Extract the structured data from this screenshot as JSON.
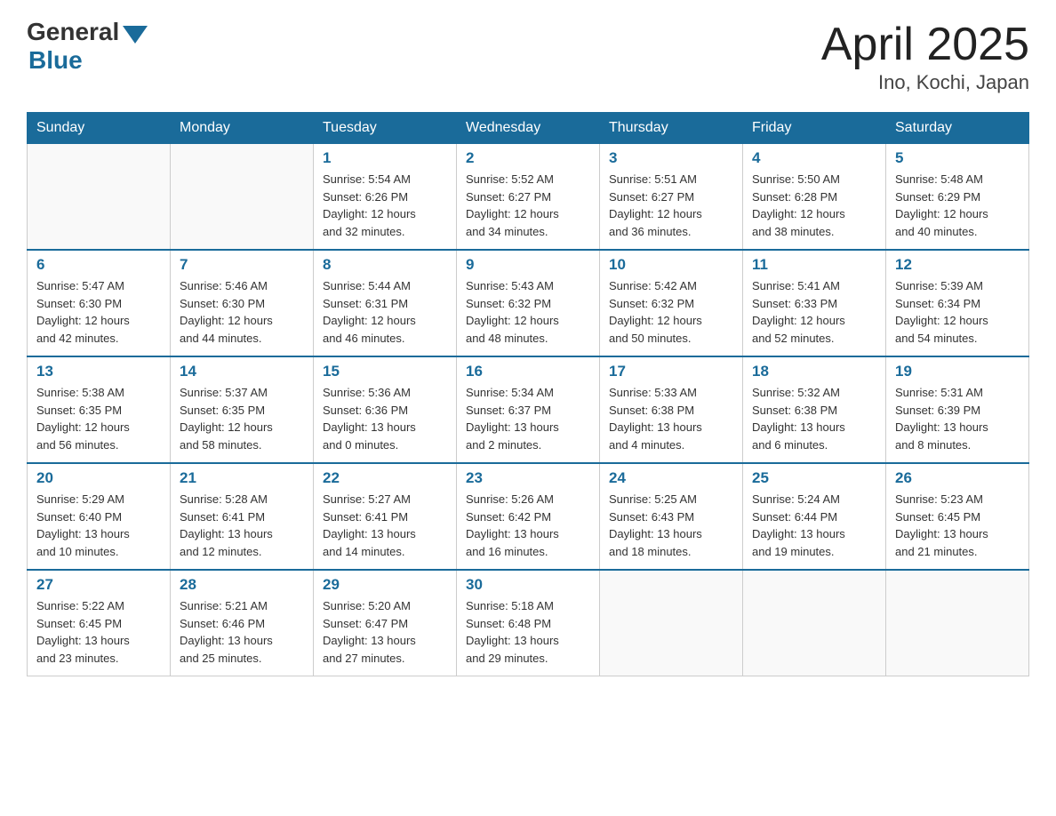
{
  "header": {
    "logo_general": "General",
    "logo_blue": "Blue",
    "title": "April 2025",
    "subtitle": "Ino, Kochi, Japan"
  },
  "weekdays": [
    "Sunday",
    "Monday",
    "Tuesday",
    "Wednesday",
    "Thursday",
    "Friday",
    "Saturday"
  ],
  "weeks": [
    [
      {
        "day": "",
        "info": ""
      },
      {
        "day": "",
        "info": ""
      },
      {
        "day": "1",
        "info": "Sunrise: 5:54 AM\nSunset: 6:26 PM\nDaylight: 12 hours\nand 32 minutes."
      },
      {
        "day": "2",
        "info": "Sunrise: 5:52 AM\nSunset: 6:27 PM\nDaylight: 12 hours\nand 34 minutes."
      },
      {
        "day": "3",
        "info": "Sunrise: 5:51 AM\nSunset: 6:27 PM\nDaylight: 12 hours\nand 36 minutes."
      },
      {
        "day": "4",
        "info": "Sunrise: 5:50 AM\nSunset: 6:28 PM\nDaylight: 12 hours\nand 38 minutes."
      },
      {
        "day": "5",
        "info": "Sunrise: 5:48 AM\nSunset: 6:29 PM\nDaylight: 12 hours\nand 40 minutes."
      }
    ],
    [
      {
        "day": "6",
        "info": "Sunrise: 5:47 AM\nSunset: 6:30 PM\nDaylight: 12 hours\nand 42 minutes."
      },
      {
        "day": "7",
        "info": "Sunrise: 5:46 AM\nSunset: 6:30 PM\nDaylight: 12 hours\nand 44 minutes."
      },
      {
        "day": "8",
        "info": "Sunrise: 5:44 AM\nSunset: 6:31 PM\nDaylight: 12 hours\nand 46 minutes."
      },
      {
        "day": "9",
        "info": "Sunrise: 5:43 AM\nSunset: 6:32 PM\nDaylight: 12 hours\nand 48 minutes."
      },
      {
        "day": "10",
        "info": "Sunrise: 5:42 AM\nSunset: 6:32 PM\nDaylight: 12 hours\nand 50 minutes."
      },
      {
        "day": "11",
        "info": "Sunrise: 5:41 AM\nSunset: 6:33 PM\nDaylight: 12 hours\nand 52 minutes."
      },
      {
        "day": "12",
        "info": "Sunrise: 5:39 AM\nSunset: 6:34 PM\nDaylight: 12 hours\nand 54 minutes."
      }
    ],
    [
      {
        "day": "13",
        "info": "Sunrise: 5:38 AM\nSunset: 6:35 PM\nDaylight: 12 hours\nand 56 minutes."
      },
      {
        "day": "14",
        "info": "Sunrise: 5:37 AM\nSunset: 6:35 PM\nDaylight: 12 hours\nand 58 minutes."
      },
      {
        "day": "15",
        "info": "Sunrise: 5:36 AM\nSunset: 6:36 PM\nDaylight: 13 hours\nand 0 minutes."
      },
      {
        "day": "16",
        "info": "Sunrise: 5:34 AM\nSunset: 6:37 PM\nDaylight: 13 hours\nand 2 minutes."
      },
      {
        "day": "17",
        "info": "Sunrise: 5:33 AM\nSunset: 6:38 PM\nDaylight: 13 hours\nand 4 minutes."
      },
      {
        "day": "18",
        "info": "Sunrise: 5:32 AM\nSunset: 6:38 PM\nDaylight: 13 hours\nand 6 minutes."
      },
      {
        "day": "19",
        "info": "Sunrise: 5:31 AM\nSunset: 6:39 PM\nDaylight: 13 hours\nand 8 minutes."
      }
    ],
    [
      {
        "day": "20",
        "info": "Sunrise: 5:29 AM\nSunset: 6:40 PM\nDaylight: 13 hours\nand 10 minutes."
      },
      {
        "day": "21",
        "info": "Sunrise: 5:28 AM\nSunset: 6:41 PM\nDaylight: 13 hours\nand 12 minutes."
      },
      {
        "day": "22",
        "info": "Sunrise: 5:27 AM\nSunset: 6:41 PM\nDaylight: 13 hours\nand 14 minutes."
      },
      {
        "day": "23",
        "info": "Sunrise: 5:26 AM\nSunset: 6:42 PM\nDaylight: 13 hours\nand 16 minutes."
      },
      {
        "day": "24",
        "info": "Sunrise: 5:25 AM\nSunset: 6:43 PM\nDaylight: 13 hours\nand 18 minutes."
      },
      {
        "day": "25",
        "info": "Sunrise: 5:24 AM\nSunset: 6:44 PM\nDaylight: 13 hours\nand 19 minutes."
      },
      {
        "day": "26",
        "info": "Sunrise: 5:23 AM\nSunset: 6:45 PM\nDaylight: 13 hours\nand 21 minutes."
      }
    ],
    [
      {
        "day": "27",
        "info": "Sunrise: 5:22 AM\nSunset: 6:45 PM\nDaylight: 13 hours\nand 23 minutes."
      },
      {
        "day": "28",
        "info": "Sunrise: 5:21 AM\nSunset: 6:46 PM\nDaylight: 13 hours\nand 25 minutes."
      },
      {
        "day": "29",
        "info": "Sunrise: 5:20 AM\nSunset: 6:47 PM\nDaylight: 13 hours\nand 27 minutes."
      },
      {
        "day": "30",
        "info": "Sunrise: 5:18 AM\nSunset: 6:48 PM\nDaylight: 13 hours\nand 29 minutes."
      },
      {
        "day": "",
        "info": ""
      },
      {
        "day": "",
        "info": ""
      },
      {
        "day": "",
        "info": ""
      }
    ]
  ]
}
